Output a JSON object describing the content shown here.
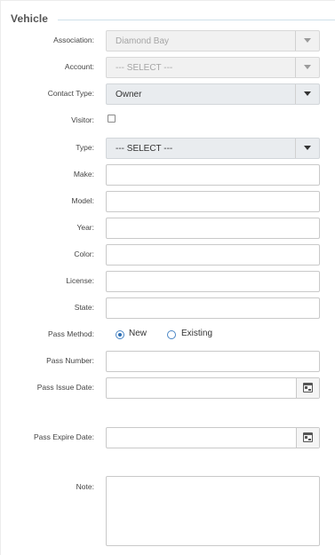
{
  "legend": {
    "title": "Vehicle"
  },
  "association": {
    "label": "Association:",
    "value": "Diamond Bay"
  },
  "account": {
    "label": "Account:",
    "value": "--- SELECT ---"
  },
  "contact_type": {
    "label": "Contact Type:",
    "value": "Owner"
  },
  "visitor": {
    "label": "Visitor:",
    "checked": false
  },
  "type": {
    "label": "Type:",
    "value": "--- SELECT ---"
  },
  "make": {
    "label": "Make:",
    "value": ""
  },
  "model": {
    "label": "Model:",
    "value": ""
  },
  "year": {
    "label": "Year:",
    "value": ""
  },
  "color": {
    "label": "Color:",
    "value": ""
  },
  "license": {
    "label": "License:",
    "value": ""
  },
  "state": {
    "label": "State:",
    "value": ""
  },
  "pass_method": {
    "label": "Pass Method:",
    "options": [
      "New",
      "Existing"
    ],
    "selected": "New"
  },
  "pass_number": {
    "label": "Pass Number:",
    "value": ""
  },
  "pass_issue_date": {
    "label": "Pass Issue Date:",
    "value": ""
  },
  "pass_expire_date": {
    "label": "Pass Expire Date:",
    "value": ""
  },
  "note": {
    "label": "Note:",
    "value": ""
  },
  "icons": {
    "dropdown": "chevron-down-icon",
    "date": "calendar-icon"
  },
  "colors": {
    "radio_accent": "#2f6fb3",
    "legend_line": "#cfe0ea",
    "disabled_bg": "#f1f1f1"
  }
}
